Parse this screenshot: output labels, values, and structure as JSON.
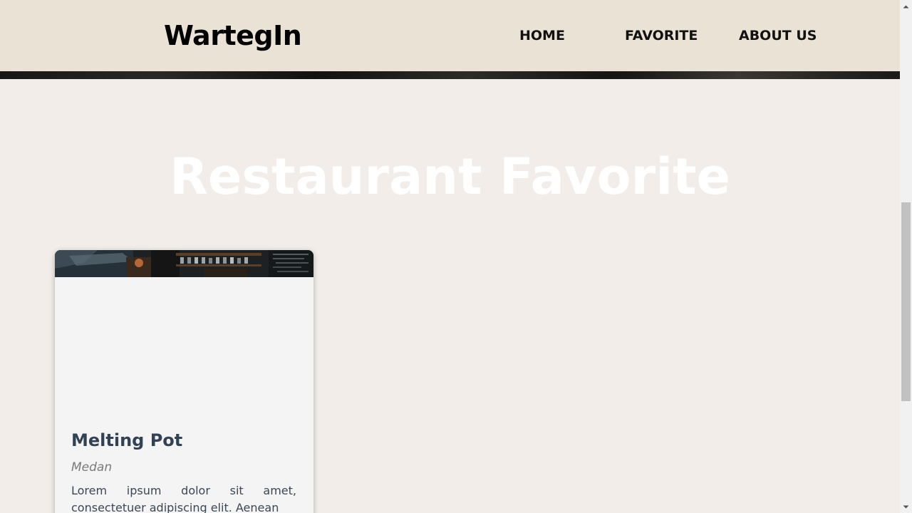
{
  "header": {
    "logo": "WartegIn",
    "nav": {
      "home": "HOME",
      "favorite": "FAVORITE",
      "about": "ABOUT US"
    }
  },
  "main": {
    "title": "Restaurant Favorite",
    "restaurants": [
      {
        "name": "Melting Pot",
        "city": "Medan",
        "description": "Lorem ipsum dolor sit amet, consectetuer adipiscing elit. Aenean"
      }
    ]
  },
  "colors": {
    "header_bg": "#ebe2d6",
    "page_bg": "#f2ede9",
    "title_text": "#ffffff",
    "card_name": "#334155"
  }
}
